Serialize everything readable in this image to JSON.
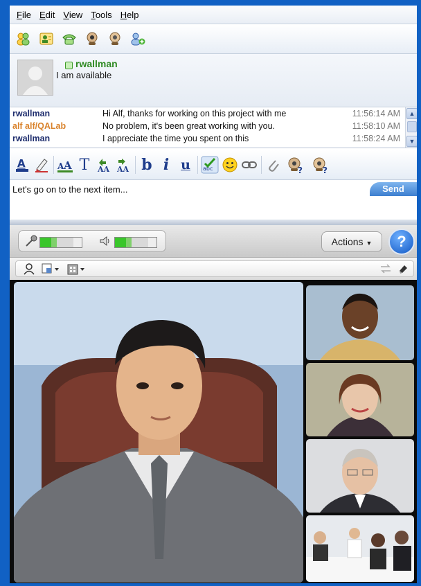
{
  "menu": [
    "File",
    "Edit",
    "View",
    "Tools",
    "Help"
  ],
  "toolbar_icons": [
    "contacts-icon",
    "address-book-icon",
    "phone-icon",
    "webcam-icon",
    "webcam-alt-icon",
    "add-contact-icon"
  ],
  "status": {
    "name": "rwallman",
    "message": "I am available"
  },
  "chat": [
    {
      "sender": "rwallman",
      "text": "Hi Alf, thanks for working on this project with me",
      "time": "11:56:14 AM",
      "color": "#1f2e6e"
    },
    {
      "sender": "alf alf/QALab",
      "text": "No problem, it's been great working with you.",
      "time": "11:58:10 AM",
      "color": "#d9822b"
    },
    {
      "sender": "rwallman",
      "text": "I appreciate the time you spent on this",
      "time": "11:58:24 AM",
      "color": "#1f2e6e"
    }
  ],
  "format_toolbar": {
    "font_color_icon": "font-color-icon",
    "highlight_icon": "highlighter-icon",
    "font_size_icon": "font-size-icon",
    "font_label": "T",
    "grow_label": "AA",
    "shrink_label": "AA",
    "bold_label": "b",
    "italic_label": "i",
    "underline_label": "u"
  },
  "compose": {
    "value": "Let's go on to the next item..."
  },
  "send_label": "Send",
  "av": {
    "actions_label": "Actions",
    "help_label": "?"
  },
  "colors": {
    "frame": "#1161c4",
    "accent_green": "#2f8a23",
    "sender_orange": "#d9822b",
    "sender_blue": "#1f2e6e"
  }
}
